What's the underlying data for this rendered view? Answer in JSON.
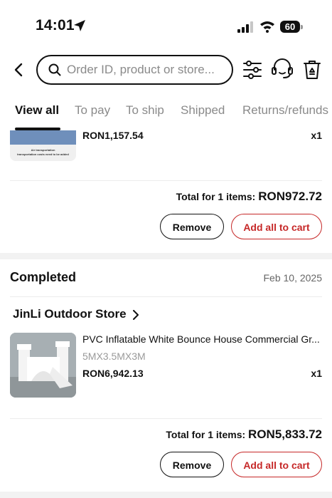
{
  "status_bar": {
    "time": "14:01",
    "battery": "60"
  },
  "header": {
    "search_placeholder": "Order ID, product or store..."
  },
  "tabs": [
    {
      "label": "View all",
      "active": true
    },
    {
      "label": "To pay",
      "active": false
    },
    {
      "label": "To ship",
      "active": false
    },
    {
      "label": "Shipped",
      "active": false
    },
    {
      "label": "Returns/refunds",
      "active": false
    }
  ],
  "orders": [
    {
      "image_text": [
        "Air transportation",
        "transportation costs need to be added"
      ],
      "item_price": "RON1,157.54",
      "item_qty": "x1",
      "total_label": "Total for 1 items:",
      "total_value": "RON972.72",
      "remove_label": "Remove",
      "cart_label": "Add all to cart"
    },
    {
      "status": "Completed",
      "date": "Feb 10, 2025",
      "store": "JinLi Outdoor Store",
      "item_title": "PVC Inflatable White Bounce House Commercial Gr...",
      "item_variant": "5MX3.5MX3M",
      "item_price": "RON6,942.13",
      "item_qty": "x1",
      "total_label": "Total for 1 items:",
      "total_value": "RON5,833.72",
      "remove_label": "Remove",
      "cart_label": "Add all to cart"
    }
  ],
  "colors": {
    "accent_red": "#c62828",
    "text": "#111111",
    "muted": "#8a8a8a"
  }
}
